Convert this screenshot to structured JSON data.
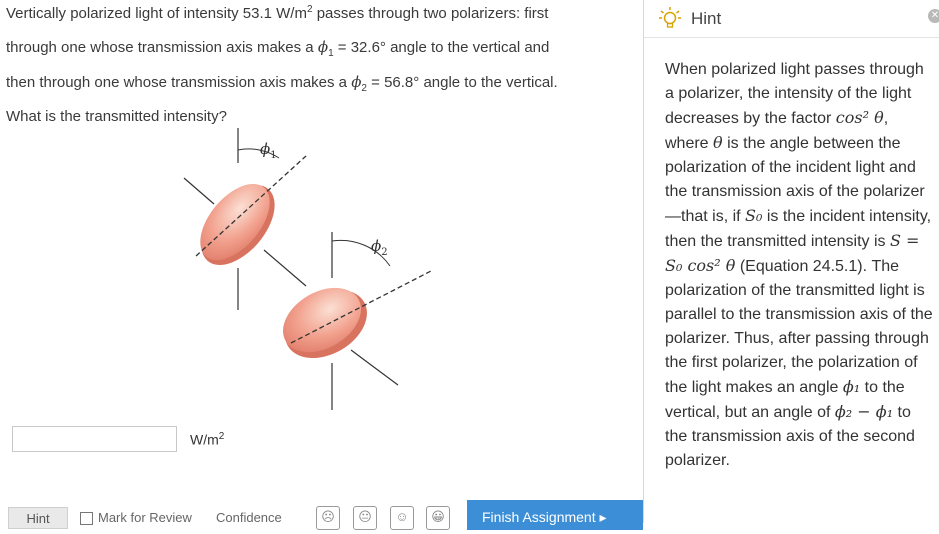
{
  "question": {
    "line1_a": "Vertically polarized light of intensity 53.1 W/m",
    "line1_sup": "2",
    "line1_b": " passes through two polarizers: first",
    "line2_a": "through one whose transmission axis makes a ",
    "phi": "ϕ",
    "sub1": "1",
    "line2_b": " = 32.6° angle to the vertical and",
    "line3_a": "then through one whose transmission axis makes a ",
    "sub2": "2",
    "line3_b": " = 56.8° angle to the vertical.",
    "line4": "What is the transmitted intensity?"
  },
  "diagram": {
    "phi1_label": "ϕ",
    "phi1_sub": "1",
    "phi2_label": "ϕ",
    "phi2_sub": "2"
  },
  "answer": {
    "value": "",
    "unit": "W/m",
    "unit_sup": "2"
  },
  "bottom": {
    "hint_label": "Hint",
    "mark_label": "Mark for Review",
    "confidence_label": "Confidence",
    "finish_label": "Finish Assignment ▸"
  },
  "hint": {
    "title": "Hint",
    "p1": "When polarized light passes through a polarizer, the intensity of the light decreases by the factor ",
    "cos2theta": "cos² θ",
    "p2": ", where ",
    "theta": "θ",
    "p3": " is the angle between the polarization of the incident light and the transmission axis of the polarizer—that is, if ",
    "S0": "S₀",
    "p4": " is the incident intensity, then the transmitted intensity is ",
    "formula": "S = S₀ cos² θ",
    "p5": " (Equation 24.5.1). The polarization of the transmitted light is parallel to the transmission axis of the polarizer. Thus, after passing through the first polarizer, the polarization of the light makes an angle ",
    "phi1": "ϕ₁",
    "p6": " to the vertical, but an angle of ",
    "phi_diff": "ϕ₂ − ϕ₁",
    "p7": " to the transmission axis of the second polarizer."
  }
}
